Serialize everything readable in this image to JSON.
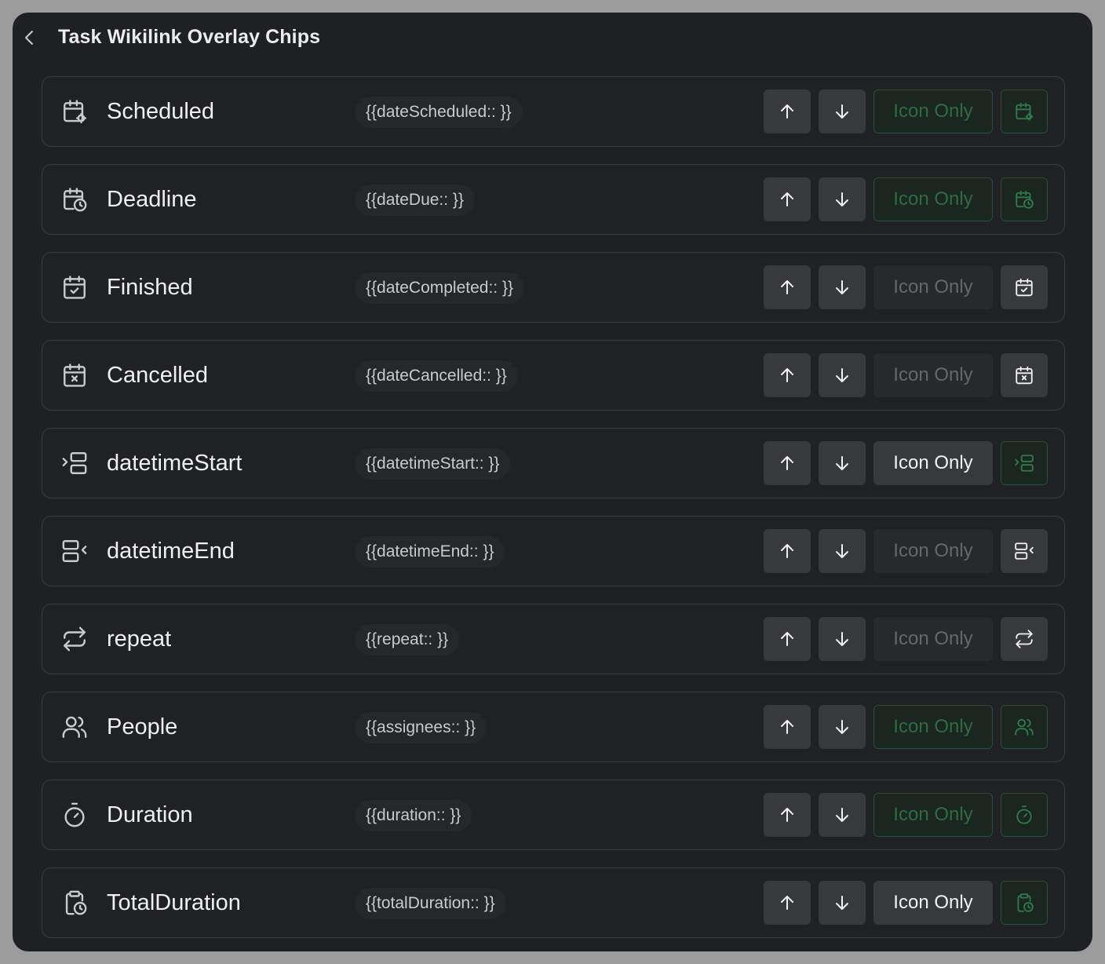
{
  "header": {
    "title": "Task Wikilink Overlay Chips",
    "back_icon": "chevron-left-icon"
  },
  "colors": {
    "window_bg": "#1f2023",
    "row_border": "#3a3b3f",
    "green_text": "#2f6a45",
    "green_border": "#2b4a37"
  },
  "rows": [
    {
      "label": "Scheduled",
      "chip": "{{dateScheduled:: }}",
      "icon": "calendar-cog-icon",
      "mode_label": "Icon Only",
      "mode_state": "green",
      "preview_state": "green"
    },
    {
      "label": "Deadline",
      "chip": "{{dateDue:: }}",
      "icon": "calendar-clock-icon",
      "mode_label": "Icon Only",
      "mode_state": "green",
      "preview_state": "green"
    },
    {
      "label": "Finished",
      "chip": "{{dateCompleted:: }}",
      "icon": "calendar-check-icon",
      "mode_label": "Icon Only",
      "mode_state": "dim",
      "preview_state": "dim"
    },
    {
      "label": "Cancelled",
      "chip": "{{dateCancelled:: }}",
      "icon": "calendar-x-icon",
      "mode_label": "Icon Only",
      "mode_state": "dim",
      "preview_state": "dim"
    },
    {
      "label": "datetimeStart",
      "chip": "{{datetimeStart:: }}",
      "icon": "align-start-icon",
      "mode_label": "Icon Only",
      "mode_state": "active",
      "preview_state": "green"
    },
    {
      "label": "datetimeEnd",
      "chip": "{{datetimeEnd:: }}",
      "icon": "align-end-icon",
      "mode_label": "Icon Only",
      "mode_state": "dim",
      "preview_state": "dim"
    },
    {
      "label": "repeat",
      "chip": "{{repeat:: }}",
      "icon": "repeat-icon",
      "mode_label": "Icon Only",
      "mode_state": "dim",
      "preview_state": "dim"
    },
    {
      "label": "People",
      "chip": "{{assignees:: }}",
      "icon": "users-icon",
      "mode_label": "Icon Only",
      "mode_state": "green",
      "preview_state": "green"
    },
    {
      "label": "Duration",
      "chip": "{{duration:: }}",
      "icon": "timer-icon",
      "mode_label": "Icon Only",
      "mode_state": "green",
      "preview_state": "green"
    },
    {
      "label": "TotalDuration",
      "chip": "{{totalDuration:: }}",
      "icon": "clipboard-clock-icon",
      "mode_label": "Icon Only",
      "mode_state": "active",
      "preview_state": "green"
    }
  ]
}
